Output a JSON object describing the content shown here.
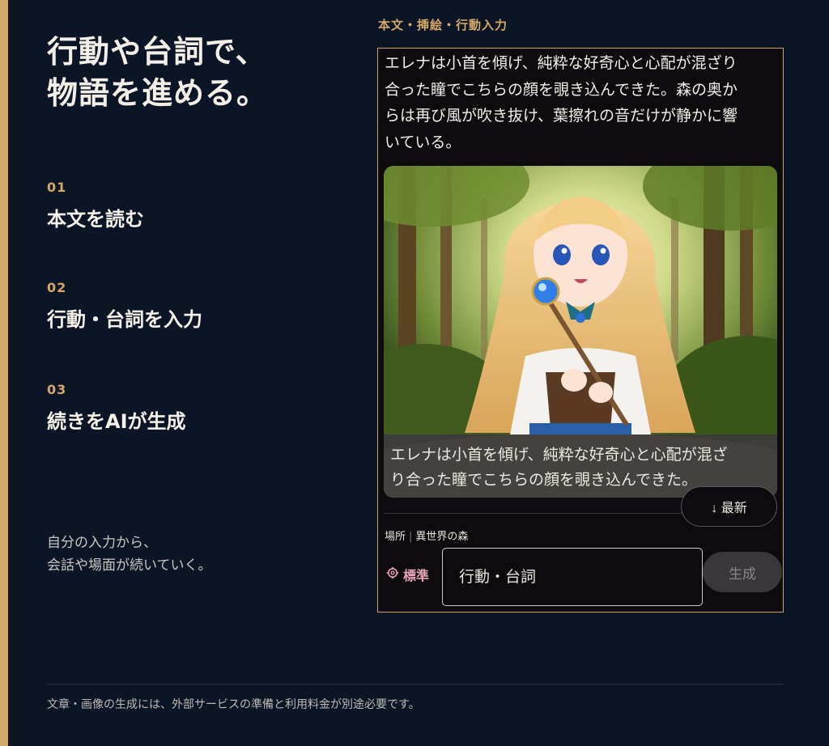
{
  "hero": {
    "line1": "行動や台詞で、",
    "line2": "物語を進める。"
  },
  "steps": [
    {
      "num": "01",
      "label": "本文を読む"
    },
    {
      "num": "02",
      "label": "行動・台詞を入力"
    },
    {
      "num": "03",
      "label": "続きをAIが生成"
    }
  ],
  "note": {
    "line1": "自分の入力から、",
    "line2": "会話や場面が続いていく。"
  },
  "footer": {
    "text": "文章・画像の生成には、外部サービスの準備と利用料金が別途必要です。"
  },
  "panel": {
    "caption": "本文・挿絵・行動入力",
    "story_lines": [
      "エレナは小首を傾げ、純粋な好奇心と心配が混ざり",
      "合った瞳でこちらの顔を覗き込んできた。森の奥か",
      "らは再び風が吹き抜け、葉擦れの音だけが静かに響",
      "いている。"
    ],
    "image_caption_lines": [
      "エレナは小首を傾げ、純粋な好奇心と心配が混ざ",
      "り合った瞳でこちらの顔を覗き込んできた。"
    ],
    "latest_button": "↓ 最新",
    "location_label": "場所",
    "location_value": "異世界の森",
    "mode_label": "標準",
    "input_placeholder": "行動・台詞",
    "generate_button": "生成"
  },
  "colors": {
    "background": "#0c1526",
    "accent_gold": "#cfa96a",
    "mode_pink": "#e7a4b6"
  },
  "icons": {
    "mode": "gear-icon",
    "latest": "arrow-down-icon"
  }
}
